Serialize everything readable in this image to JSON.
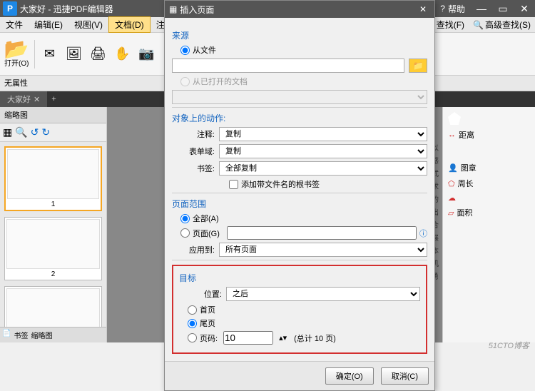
{
  "titlebar": {
    "title": "大家好 - 迅捷PDF编辑器",
    "help": "帮助"
  },
  "menu": {
    "file": "文件",
    "edit": "编辑(E)",
    "view": "视图(V)",
    "doc": "文档(D)",
    "annot": "注释(C)",
    "find": "查找(F)",
    "advfind": "高级查找(S)"
  },
  "toolbar": {
    "open": "打开(O)"
  },
  "noprop": "无属性",
  "tab": {
    "name": "大家好"
  },
  "sidebar": {
    "title": "缩略图",
    "p1": "1",
    "p2": "2",
    "bookmark": "书签",
    "thumbs": "缩略图"
  },
  "right": {
    "distance": "距离",
    "perimeter": "周长",
    "area": "面积",
    "person": "图章"
  },
  "doctext": [
    "家属们以",
    "心的感",
    "",
    "至并正式",
    "事要求",
    "了坚实的",
    "",
    "针，提出",
    "好、综合",
    "团的发展",
    "司上下本",
    "抢抓机",
    "建设，勇",
    "勇拼搏。"
  ],
  "dialog": {
    "title": "插入页面",
    "source": "来源",
    "from_file": "从文件",
    "from_open": "从已打开的文档",
    "action": "对象上的动作:",
    "annot_label": "注释:",
    "annot_val": "复制",
    "field_label": "表单域:",
    "field_val": "复制",
    "bookmark_label": "书签:",
    "bookmark_val": "全部复制",
    "add_named_bookmark": "添加带文件名的根书签",
    "range": "页面范围",
    "all": "全部(A)",
    "pages": "页面(G)",
    "apply_to": "应用到:",
    "apply_val": "所有页面",
    "target": "目标",
    "position": "位置:",
    "position_val": "之后",
    "first": "首页",
    "last": "尾页",
    "pagenum": "页码:",
    "pagenum_val": "10",
    "total": "(总计 10 页)",
    "ok": "确定(O)",
    "cancel": "取消(C)"
  },
  "watermark": "51CTO博客"
}
